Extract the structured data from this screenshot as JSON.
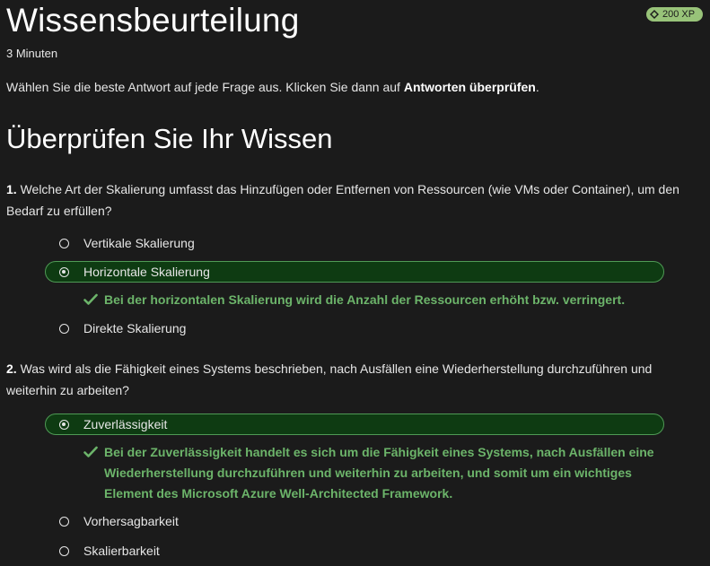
{
  "header": {
    "title": "Wissensbeurteilung",
    "xp_badge": "200 XP",
    "duration": "3 Minuten",
    "intro_prefix": "Wählen Sie die beste Antwort auf jede Frage aus. Klicken Sie dann auf ",
    "intro_bold": "Antworten überprüfen",
    "intro_suffix": "."
  },
  "section": {
    "title": "Überprüfen Sie Ihr Wissen"
  },
  "questions": [
    {
      "number": "1.",
      "text": " Welche Art der Skalierung umfasst das Hinzufügen oder Entfernen von Ressourcen (wie VMs oder Container), um den Bedarf zu erfüllen?",
      "options": [
        {
          "label": "Vertikale Skalierung",
          "selected": false
        },
        {
          "label": "Horizontale Skalierung",
          "selected": true
        },
        {
          "label": "Direkte Skalierung",
          "selected": false
        }
      ],
      "feedback": "Bei der horizontalen Skalierung wird die Anzahl der Ressourcen erhöht bzw. verringert."
    },
    {
      "number": "2.",
      "text": " Was wird als die Fähigkeit eines Systems beschrieben, nach Ausfällen eine Wiederherstellung durchzuführen und weiterhin zu arbeiten?",
      "options": [
        {
          "label": "Zuverlässigkeit",
          "selected": true
        },
        {
          "label": "Vorhersagbarkeit",
          "selected": false
        },
        {
          "label": "Skalierbarkeit",
          "selected": false
        }
      ],
      "feedback": "Bei der Zuverlässigkeit handelt es sich um die Fähigkeit eines Systems, nach Ausfällen eine Wiederherstellung durchzuführen und weiterhin zu arbeiten, und somit um ein wichtiges Element des Microsoft Azure Well-Architected Framework."
    }
  ],
  "colors": {
    "background": "#1b1b1b",
    "selected_fill": "#0e3b12",
    "selected_border": "#4f9a55",
    "success_text": "#6cb46a",
    "xp_badge": "#98c379"
  },
  "icons": {
    "radio": "radio-button-icon",
    "check": "checkmark-icon",
    "xp": "xp-gem-icon"
  }
}
